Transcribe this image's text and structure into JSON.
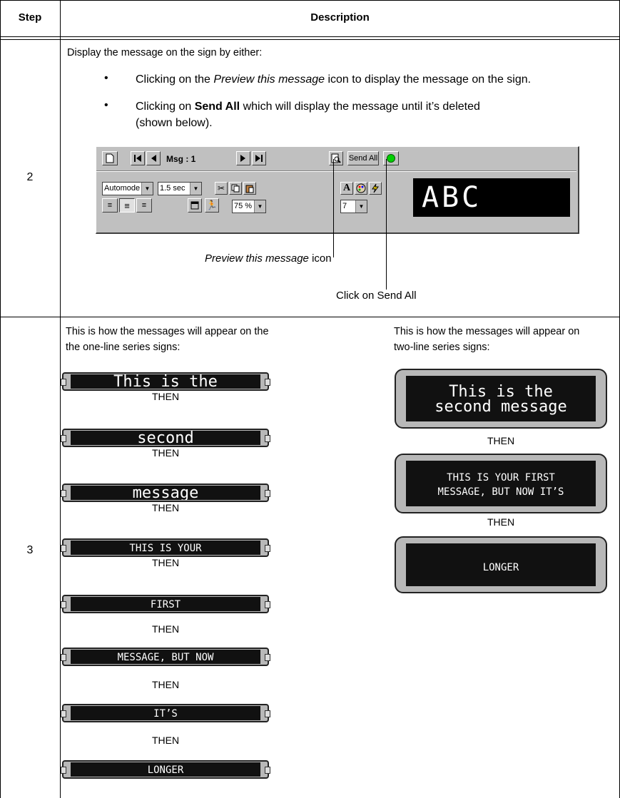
{
  "table": {
    "header_step": "Step",
    "header_description": "Description"
  },
  "step2": {
    "number": "2",
    "intro": "Display the message on the sign by either:",
    "bullet1_pre": "Clicking on the ",
    "bullet1_em": "Preview this message",
    "bullet1_post": " icon to display the message on the sign.",
    "bullet2_pre": "Clicking on ",
    "bullet2_bold": "Send All",
    "bullet2_post": " which will display the message until it’s deleted",
    "bullet2_line2": "(shown below).",
    "callout_preview_em": "Preview this message",
    "callout_preview_rest": " icon",
    "callout_sendall": "Click on Send All",
    "toolbar": {
      "msg_label": "Msg : 1",
      "send_all": "Send All",
      "mode": "Automode",
      "speed": "1.5 sec",
      "zoom": "75 %",
      "font_size": "7",
      "led_text": "ABC"
    }
  },
  "step3": {
    "number": "3",
    "left_intro_1": "This is how the messages will appear on the",
    "left_intro_2": "the one-line series signs:",
    "right_intro_1": "This is how the messages will appear on",
    "right_intro_2": " two-line series signs:",
    "then": "THEN",
    "one_line_signs": [
      "This is the",
      "second",
      "message",
      "THIS IS YOUR",
      "FIRST",
      "MESSAGE, BUT NOW",
      "IT’S",
      "LONGER"
    ],
    "two_line_signs": [
      {
        "line1": "This is the",
        "line2": "second message"
      },
      {
        "line1": "THIS IS YOUR FIRST",
        "line2": "MESSAGE, BUT NOW IT’S"
      },
      {
        "line1": "LONGER",
        "line2": ""
      }
    ]
  }
}
